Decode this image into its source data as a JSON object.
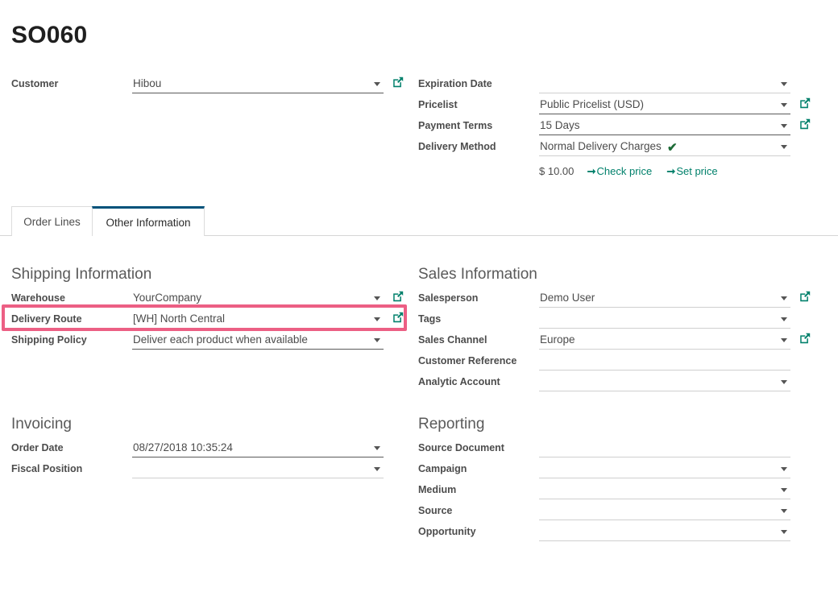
{
  "document": {
    "title": "SO060"
  },
  "header": {
    "left_fields": [
      {
        "label": "Customer",
        "value": "Hibou",
        "has_caret": true,
        "has_extlink": true,
        "filled": true
      }
    ],
    "right_fields": [
      {
        "label": "Expiration Date",
        "value": "",
        "has_caret": true,
        "has_extlink": false,
        "filled": false
      },
      {
        "label": "Pricelist",
        "value": "Public Pricelist (USD)",
        "has_caret": true,
        "has_extlink": true,
        "filled": true
      },
      {
        "label": "Payment Terms",
        "value": "15 Days",
        "has_caret": true,
        "has_extlink": true,
        "filled": true
      },
      {
        "label": "Delivery Method",
        "value": "Normal Delivery Charges",
        "has_caret": true,
        "has_extlink": false,
        "filled": false
      }
    ],
    "delivery_check_icon": "check-icon",
    "price": {
      "amount": "$ 10.00",
      "check_price_label": "Check price",
      "set_price_label": "Set price",
      "arrow_icon": "arrow-right-icon"
    }
  },
  "tabs": [
    {
      "label": "Order Lines",
      "active": false
    },
    {
      "label": "Other Information",
      "active": true
    }
  ],
  "sections": {
    "shipping": {
      "heading": "Shipping Information",
      "fields": [
        {
          "label": "Warehouse",
          "value": "YourCompany",
          "has_caret": true,
          "has_extlink": true,
          "filled": false,
          "highlighted": false
        },
        {
          "label": "Delivery Route",
          "value": "[WH] North Central",
          "has_caret": true,
          "has_extlink": true,
          "filled": false,
          "highlighted": true
        },
        {
          "label": "Shipping Policy",
          "value": "Deliver each product when available",
          "has_caret": true,
          "has_extlink": false,
          "filled": true,
          "highlighted": false
        }
      ]
    },
    "sales": {
      "heading": "Sales Information",
      "fields": [
        {
          "label": "Salesperson",
          "value": "Demo User",
          "has_caret": true,
          "has_extlink": true,
          "filled": false
        },
        {
          "label": "Tags",
          "value": "",
          "has_caret": true,
          "has_extlink": false,
          "filled": false
        },
        {
          "label": "Sales Channel",
          "value": "Europe",
          "has_caret": true,
          "has_extlink": true,
          "filled": false
        },
        {
          "label": "Customer Reference",
          "value": "",
          "has_caret": false,
          "has_extlink": false,
          "filled": false
        },
        {
          "label": "Analytic Account",
          "value": "",
          "has_caret": true,
          "has_extlink": false,
          "filled": false
        }
      ]
    },
    "invoicing": {
      "heading": "Invoicing",
      "fields": [
        {
          "label": "Order Date",
          "value": "08/27/2018 10:35:24",
          "has_caret": true,
          "has_extlink": false,
          "filled": true
        },
        {
          "label": "Fiscal Position",
          "value": "",
          "has_caret": true,
          "has_extlink": false,
          "filled": false
        }
      ]
    },
    "reporting": {
      "heading": "Reporting",
      "fields": [
        {
          "label": "Source Document",
          "value": "",
          "has_caret": false,
          "has_extlink": false,
          "filled": false
        },
        {
          "label": "Campaign",
          "value": "",
          "has_caret": true,
          "has_extlink": false,
          "filled": false
        },
        {
          "label": "Medium",
          "value": "",
          "has_caret": true,
          "has_extlink": false,
          "filled": false
        },
        {
          "label": "Source",
          "value": "",
          "has_caret": true,
          "has_extlink": false,
          "filled": false
        },
        {
          "label": "Opportunity",
          "value": "",
          "has_caret": true,
          "has_extlink": false,
          "filled": false
        }
      ]
    }
  },
  "colors": {
    "accent_teal": "#00806b",
    "tab_active_border": "#00527a",
    "highlight_pink": "#ec5f84",
    "check_green": "#1d6b37",
    "label_gray": "#4c4c4c",
    "heading_gray": "#5a5a5a"
  }
}
